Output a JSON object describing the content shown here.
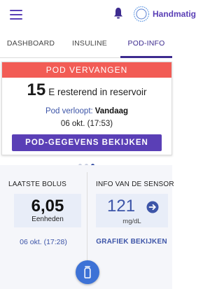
{
  "header": {
    "menu_icon": "hamburger-menu-icon",
    "bell_icon": "bell-icon",
    "mode_icon": "manual-mode-dial-icon",
    "mode_label": "Handmatig"
  },
  "tabs": [
    {
      "label": "DASHBOARD",
      "active": false
    },
    {
      "label": "INSULINE",
      "active": false
    },
    {
      "label": "POD-INFO",
      "active": true
    }
  ],
  "pod_card": {
    "alert": "POD VERVANGEN",
    "reservoir_units": "15",
    "reservoir_text": "E resterend in reservoir",
    "expires_label": "Pod verloopt:",
    "expires_value": "Vandaag",
    "expires_datetime": "06 okt. (17:53)",
    "details_button": "POD-GEGEVENS BEKIJKEN"
  },
  "pager": {
    "count": 3,
    "active_index": 2
  },
  "last_bolus": {
    "title": "LAATSTE BOLUS",
    "value": "6,05",
    "unit": "Eenheden",
    "datetime": "06 okt. (17:28)"
  },
  "sensor": {
    "title": "INFO VAN DE SENSOR",
    "value": "121",
    "trend_icon": "arrow-right-circle-icon",
    "unit": "mg/dL",
    "link": "GRAFIEK BEKIJKEN"
  },
  "bolus_button_icon": "bolus-cup-icon",
  "colors": {
    "primary": "#5a3fb6",
    "alert": "#f25c55",
    "link_blue": "#3d55a8",
    "fab_blue": "#3d72d6"
  }
}
